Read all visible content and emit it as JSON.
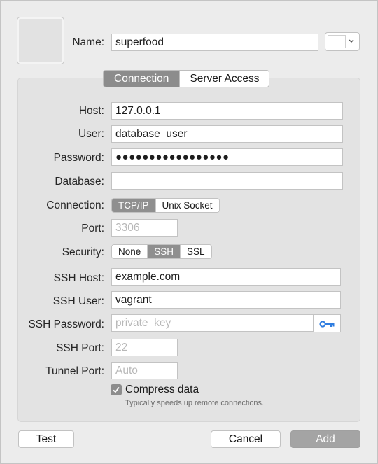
{
  "name_label": "Name:",
  "name_value": "superfood",
  "icons": {
    "color_picker": "chevron-down-icon",
    "ssh_key": "key-icon",
    "checkmark": "checkmark-icon"
  },
  "colors": {
    "key_icon": "#2f7de0",
    "selected_segment": "#8c8c8c",
    "primary_button": "#a4a4a4"
  },
  "tabs": [
    {
      "label": "Connection",
      "selected": true
    },
    {
      "label": "Server Access",
      "selected": false
    }
  ],
  "form": {
    "host": {
      "label": "Host:",
      "value": "127.0.0.1"
    },
    "user": {
      "label": "User:",
      "value": "database_user"
    },
    "password": {
      "label": "Password:",
      "value": "●●●●●●●●●●●●●●●●●"
    },
    "database": {
      "label": "Database:",
      "value": ""
    },
    "connection": {
      "label": "Connection:",
      "options": [
        "TCP/IP",
        "Unix Socket"
      ],
      "selected": "TCP/IP"
    },
    "port": {
      "label": "Port:",
      "placeholder": "3306"
    },
    "security": {
      "label": "Security:",
      "options": [
        "None",
        "SSH",
        "SSL"
      ],
      "selected": "SSH"
    },
    "ssh_host": {
      "label": "SSH Host:",
      "value": "example.com"
    },
    "ssh_user": {
      "label": "SSH User:",
      "value": "vagrant"
    },
    "ssh_password": {
      "label": "SSH Password:",
      "placeholder": "private_key"
    },
    "ssh_port": {
      "label": "SSH Port:",
      "placeholder": "22"
    },
    "tunnel_port": {
      "label": "Tunnel Port:",
      "placeholder": "Auto"
    },
    "compress": {
      "label": "Compress data",
      "hint": "Typically speeds up remote connections.",
      "checked": true
    }
  },
  "buttons": {
    "test": "Test",
    "cancel": "Cancel",
    "add": "Add"
  }
}
